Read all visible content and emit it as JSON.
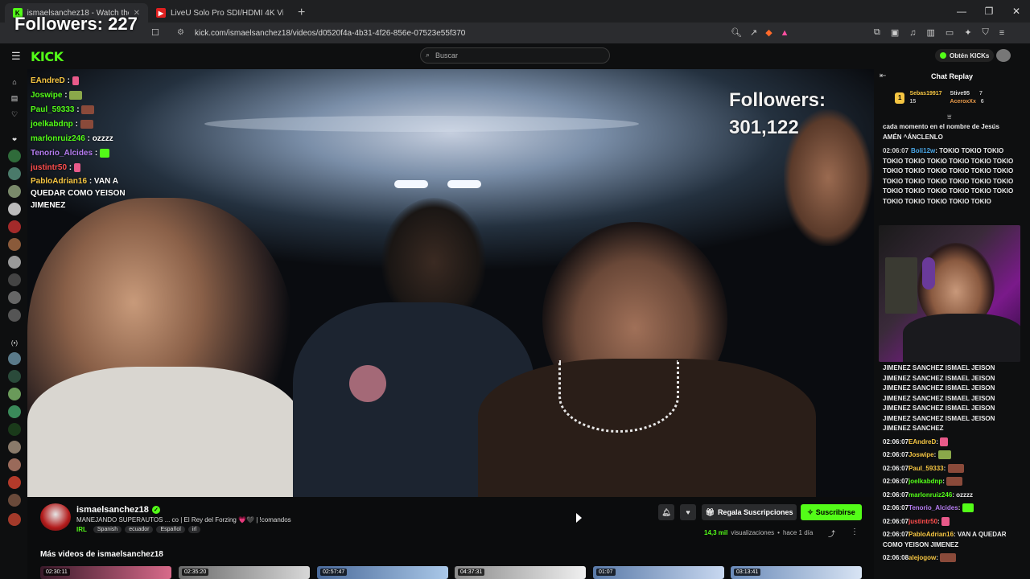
{
  "browser": {
    "tabs": [
      {
        "label": "ismaelsanchez18 - Watch the",
        "favicon": "K",
        "active": true
      },
      {
        "label": "LiveU Solo Pro SDI/HDMI 4K Video/A",
        "favicon": "▶",
        "active": false
      }
    ],
    "url": "kick.com/ismaelsanchez18/videos/d0520f4a-4b31-4f26-856e-07523e55f370"
  },
  "overlay": {
    "followers_text": "Followers: 227"
  },
  "header": {
    "logo": "KICK",
    "search_placeholder": "Buscar",
    "kicks_button": "Obtén KICKs"
  },
  "video": {
    "followers_label": "Followers:",
    "followers_count": "301,122",
    "chat_overlay": [
      {
        "user": "EAndreD",
        "text": ":"
      },
      {
        "user": "Joswipe",
        "text": ":"
      },
      {
        "user": "Paul_59333",
        "text": ":"
      },
      {
        "user": "joelkabdnp",
        "text": ":"
      },
      {
        "user": "marlonruiz246",
        "text": ": ozzzz"
      },
      {
        "user": "Tenorio_Alcides",
        "text": ":"
      },
      {
        "user": "justintr50",
        "text": ":"
      },
      {
        "user": "PabloAdrian16",
        "text": ": VAN A QUEDAR COMO YEISON JIMENEZ"
      }
    ]
  },
  "stream": {
    "streamer": "ismaelsanchez18",
    "title": "MANEJANDO SUPERAUTOS ... co | El Rey del Forzing 💗🖤 | !comandos",
    "category": "IRL",
    "tags": [
      "Spanish",
      "ecuador",
      "Español",
      "irl"
    ],
    "gift_button": "Regala Suscripciones",
    "subscribe_button": "Suscribirse",
    "views": "14,3 mil",
    "views_label": "visualizaciones",
    "age": "hace 1 día",
    "more_title": "Más videos de ismaelsanchez18",
    "thumbnails": [
      "02:30:11",
      "02:35:20",
      "02:57:47",
      "04:37:31",
      "01:07",
      "03:13:41"
    ]
  },
  "chat": {
    "title": "Chat Replay",
    "gifters": [
      {
        "name": "Sebas19917",
        "count": "15"
      },
      {
        "name": "Stive95",
        "count": "7"
      },
      {
        "name": "AceroxXx",
        "count": "6"
      }
    ],
    "top_message": "cada momento en el nombre de Jesús AMÉN ^ÁNCLENLO",
    "spam_message": {
      "ts": "02:06:07",
      "user": "Boli12w",
      "text": ": TOKIO TOKIO TOKIO TOKIO TOKIO TOKIO TOKIO TOKIO TOKIO TOKIO TOKIO TOKIO TOKIO TOKIO TOKIO TOKIO TOKIO TOKIO TOKIO TOKIO TOKIO TOKIO TOKIO TOKIO TOKIO TOKIO TOKIO TOKIO TOKIO TOKIO TOKIO TOKIO"
    },
    "jimenez_text": "JIMENEZ SANCHEZ ISMAEL JEISON JIMENEZ SANCHEZ ISMAEL JEISON JIMENEZ SANCHEZ ISMAEL JEISON JIMENEZ SANCHEZ ISMAEL JEISON JIMENEZ SANCHEZ ISMAEL JEISON JIMENEZ SANCHEZ ISMAEL JEISON JIMENEZ SANCHEZ",
    "messages": [
      {
        "ts": "02:06:07",
        "user": "EAndreD",
        "text": ":",
        "color": "#f5c542"
      },
      {
        "ts": "02:06:07",
        "user": "Joswipe",
        "text": ":",
        "color": "#f5c542"
      },
      {
        "ts": "02:06:07",
        "user": "Paul_59333",
        "text": ":",
        "color": "#f5c542"
      },
      {
        "ts": "02:06:07",
        "user": "joelkabdnp",
        "text": ":",
        "color": "#53fc18"
      },
      {
        "ts": "02:06:07",
        "user": "marlonruiz246",
        "text": ": ozzzz",
        "color": "#53fc18"
      },
      {
        "ts": "02:06:07",
        "user": "Tenorio_Alcides",
        "text": ":",
        "color": "#b57cf0"
      },
      {
        "ts": "02:06:07",
        "user": "justintr50",
        "text": ":",
        "color": "#ff4d4d"
      },
      {
        "ts": "02:06:07",
        "user": "PabloAdrian16",
        "text": ": VAN A QUEDAR COMO YEISON JIMENEZ",
        "color": "#f5c542"
      },
      {
        "ts": "02:06:08",
        "user": "alejogow",
        "text": ":",
        "color": "#f5c542"
      }
    ]
  }
}
